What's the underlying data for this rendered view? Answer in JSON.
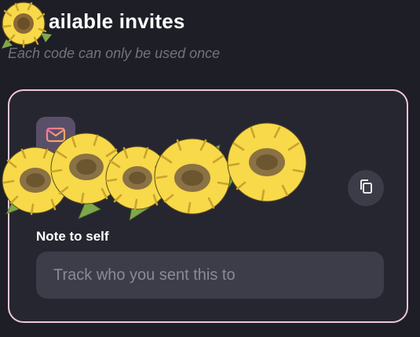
{
  "invites": {
    "title": "ailable invites",
    "subtitle": "Each code can only be used once"
  },
  "card": {
    "mail_icon": "mail-heart-icon",
    "copy_icon": "copy-icon",
    "note_label": "Note to self",
    "note_placeholder": "Track who you sent this to",
    "note_value": ""
  },
  "decoration": {
    "sunflower_sticker": "sunflower-garland-sticker"
  },
  "colors": {
    "background": "#1e1e27",
    "card_background": "#262631",
    "card_border": "#f2c6d9",
    "input_background": "#3d3d49",
    "muted_text": "#73737f",
    "petal_yellow": "#f7d94a",
    "flower_center": "#7d6430"
  }
}
